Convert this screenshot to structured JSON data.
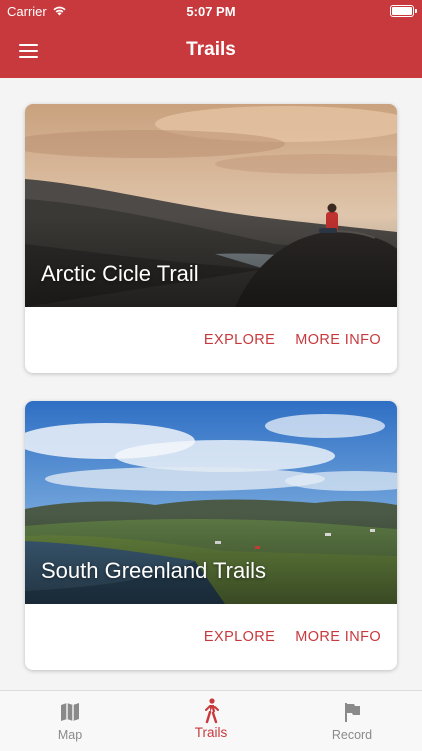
{
  "status_bar": {
    "carrier": "Carrier",
    "time": "5:07 PM",
    "icons": [
      "wifi-icon",
      "battery-icon"
    ]
  },
  "nav": {
    "title": "Trails",
    "menu_icon": "hamburger-menu-icon"
  },
  "colors": {
    "brand": "#c8393d",
    "tab_inactive": "#8a8a8a",
    "background": "#f4f4f4"
  },
  "trails": [
    {
      "title": "Arctic Cicle Trail",
      "explore_label": "EXPLORE",
      "more_info_label": "MORE INFO"
    },
    {
      "title": "South Greenland Trails",
      "explore_label": "EXPLORE",
      "more_info_label": "MORE INFO"
    }
  ],
  "tabs": [
    {
      "label": "Map",
      "icon": "map-icon",
      "active": false
    },
    {
      "label": "Trails",
      "icon": "hiker-icon",
      "active": true
    },
    {
      "label": "Record",
      "icon": "flag-icon",
      "active": false
    }
  ]
}
